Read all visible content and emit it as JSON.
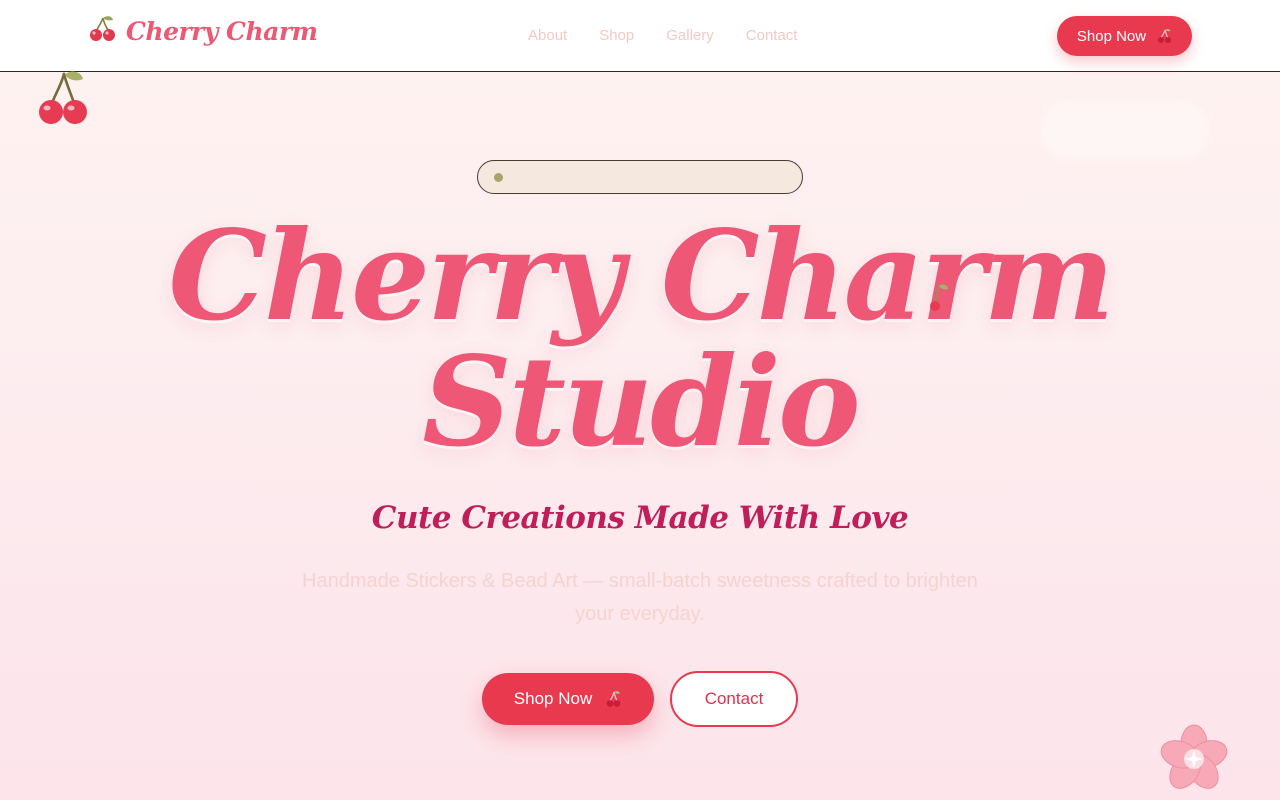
{
  "header": {
    "logo_icon": "cherry-icon",
    "logo_text": "Cherry Charm",
    "nav": [
      {
        "label": "About"
      },
      {
        "label": "Shop"
      },
      {
        "label": "Gallery"
      },
      {
        "label": "Contact"
      }
    ],
    "cta_label": "Shop Now",
    "cta_icon": "cherry-icon"
  },
  "hero": {
    "badge_text": "",
    "title_line1": "Cherry Charm",
    "title_line2": "Studio",
    "subtitle": "Cute Creations Made With Love",
    "description": "Handmade Stickers & Bead Art — small-batch sweetness crafted to brighten your everyday.",
    "primary_label": "Shop Now",
    "primary_icon": "cherry-icon",
    "secondary_label": "Contact"
  },
  "decorations": {
    "corner_icon": "cherry-icon",
    "flower_icon": "sakura-flower-icon"
  },
  "colors": {
    "brand_red": "#e8394f",
    "title_pink": "#ee5775",
    "subtitle_magenta": "#c01e58",
    "nav_text": "#f3c9c5",
    "background_top": "#fef3f0",
    "background_bottom": "#fce4ea"
  }
}
